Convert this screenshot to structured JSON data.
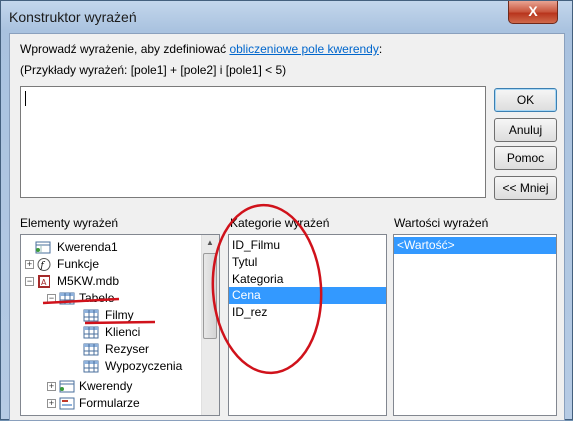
{
  "window": {
    "title": "Konstruktor wyrażeń",
    "close_label": "X"
  },
  "instructions": {
    "line1_prefix": "Wprowadź wyrażenie, aby zdefiniować ",
    "line1_link": "obliczeniowe pole kwerendy",
    "line1_suffix": ":",
    "line2": "(Przykłady wyrażeń: [pole1] + [pole2] i [pole1] < 5)"
  },
  "expression_input": {
    "value": ""
  },
  "buttons": {
    "ok": "OK",
    "cancel": "Anuluj",
    "help": "Pomoc",
    "less": "<< Mniej"
  },
  "sections": {
    "elements_label": "Elementy wyrażeń",
    "categories_label": "Kategorie wyrażeń",
    "values_label": "Wartości wyrażeń"
  },
  "tree": [
    {
      "label": "Kwerenda1"
    },
    {
      "label": "Funkcje"
    },
    {
      "label": "M5KW.mdb"
    },
    {
      "label": "Tabele"
    },
    {
      "label": "Filmy"
    },
    {
      "label": "Klienci"
    },
    {
      "label": "Rezyser"
    },
    {
      "label": "Wypozyczenia"
    },
    {
      "label": "Kwerendy"
    },
    {
      "label": "Formularze"
    }
  ],
  "categories": [
    "ID_Filmu",
    "Tytul",
    "Kategoria",
    "Cena",
    "ID_rez"
  ],
  "selected_category": "Cena",
  "values": [
    "<Wartość>"
  ],
  "colors": {
    "selection": "#3399ff",
    "annotation": "#d0121b",
    "link": "#0066cc"
  },
  "icons": [
    "query-icon",
    "function-icon",
    "database-icon",
    "table-icon",
    "form-icon"
  ]
}
